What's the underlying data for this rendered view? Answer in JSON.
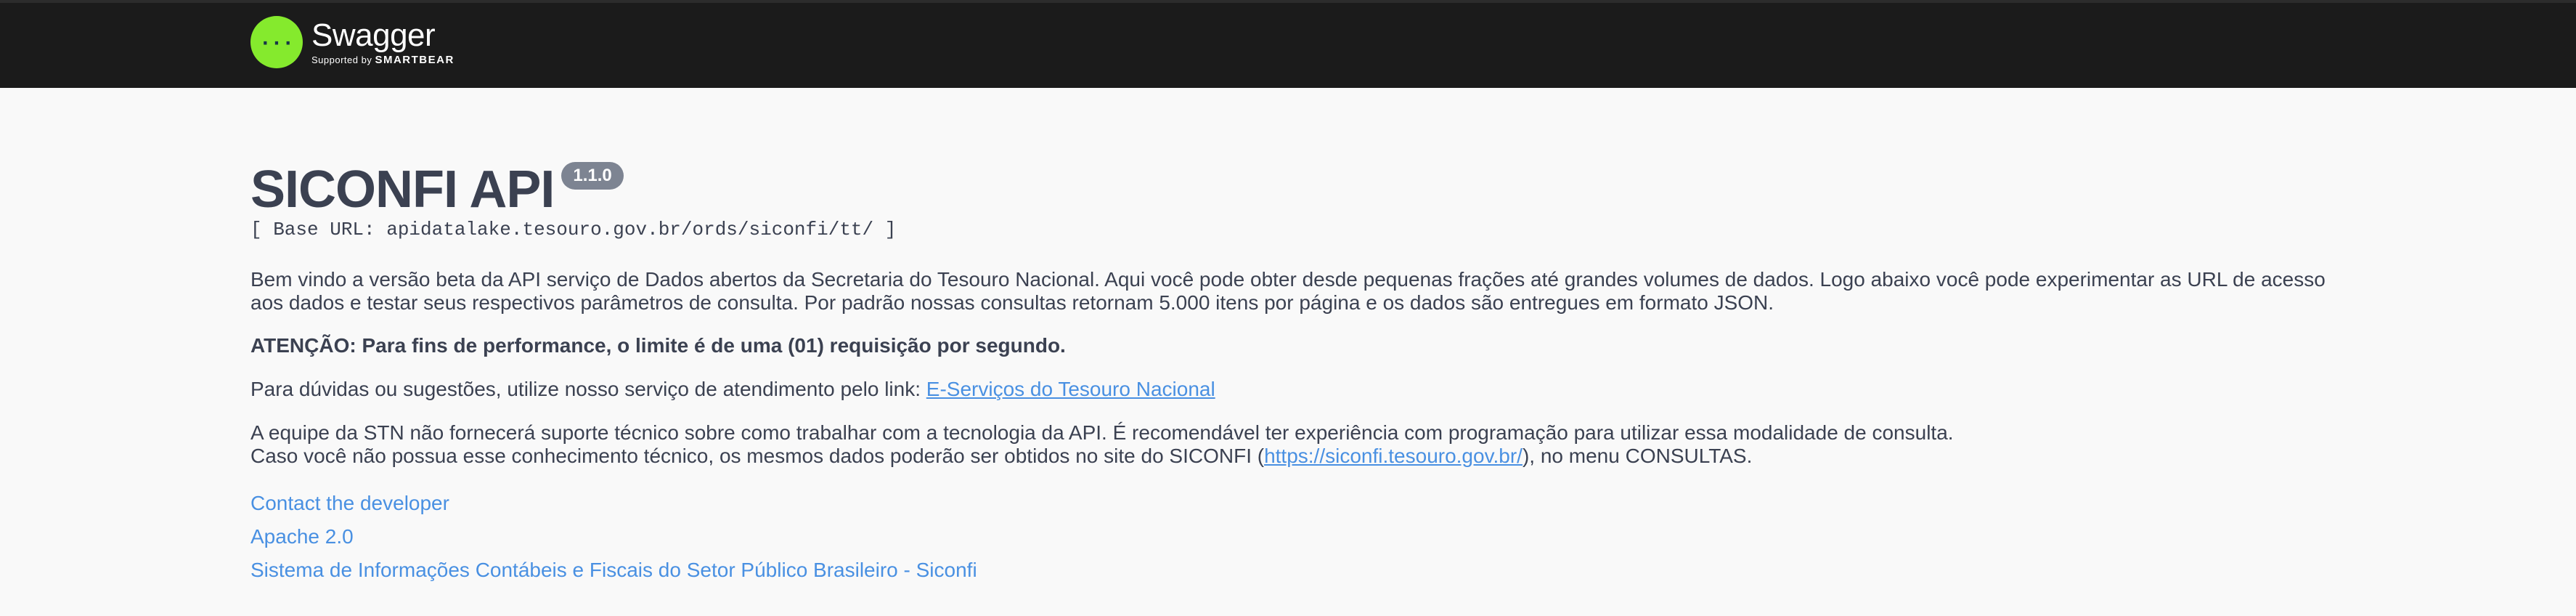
{
  "header": {
    "logo_name": "Swagger",
    "logo_sub_prefix": "Supported by",
    "logo_sub_brand": "SMARTBEAR",
    "logo_glyph": "{...}"
  },
  "info": {
    "title": "SICONFI API",
    "version": "1.1.0",
    "base_url": "[ Base URL: apidatalake.tesouro.gov.br/ords/siconfi/tt/ ]",
    "paragraph1": "Bem vindo a versão beta da API serviço de Dados abertos da Secretaria do Tesouro Nacional. Aqui você pode obter desde pequenas frações até grandes volumes de dados. Logo abaixo você pode experimentar as URL de acesso aos dados e testar seus respectivos parâmetros de consulta. Por padrão nossas consultas retornam 5.000 itens por página e os dados são entregues em formato JSON.",
    "attention": "ATENÇÃO: Para fins de performance, o limite é de uma (01) requisição por segundo.",
    "support_text": "Para dúvidas ou sugestões, utilize nosso serviço de atendimento pelo link: ",
    "support_link": "E-Serviços do Tesouro Nacional",
    "disclaimer_line1": "A equipe da STN não fornecerá suporte técnico sobre como trabalhar com a tecnologia da API. É recomendável ter experiência com programação para utilizar essa modalidade de consulta.",
    "disclaimer_line2_before": "Caso você não possua esse conhecimento técnico, os mesmos dados poderão ser obtidos no site do SICONFI (",
    "disclaimer_line2_link": "https://siconfi.tesouro.gov.br/",
    "disclaimer_line2_after": "), no menu CONSULTAS.",
    "contact_link": "Contact the developer",
    "license_link": "Apache 2.0",
    "external_docs_link": "Sistema de Informações Contábeis e Fiscais do Setor Público Brasileiro - Siconfi"
  },
  "colors": {
    "topbar": "#1b1b1b",
    "logo_green": "#85ea2d",
    "text": "#3b4151",
    "link": "#4990e2",
    "version_badge": "#7d8492"
  }
}
